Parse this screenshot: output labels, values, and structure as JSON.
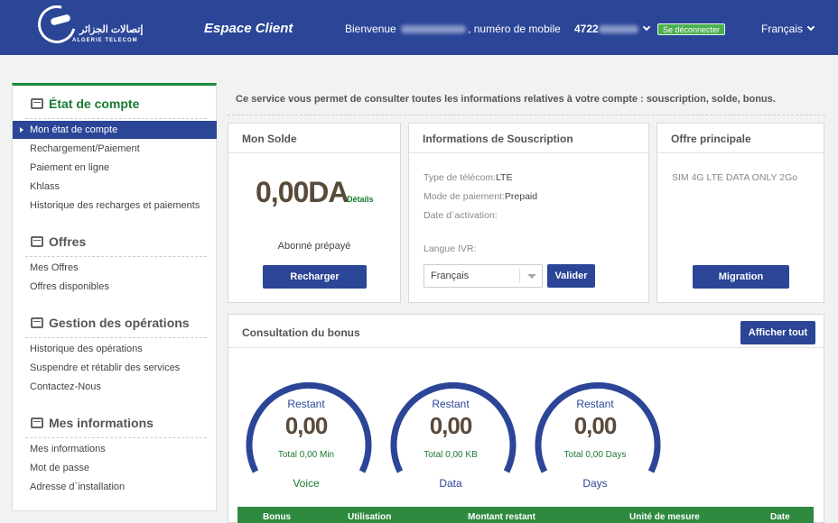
{
  "header": {
    "logo_arabic": "إتصالات الجزائر",
    "logo_latin": "ALGERIE TELECOM",
    "espace_title": "Espace Client",
    "welcome_prefix": "Bienvenue",
    "welcome_suffix": ", numéro de mobile",
    "phone_prefix": "4722",
    "logout_label": "Se déconnecter",
    "language": "Français"
  },
  "sidebar": {
    "sections": [
      {
        "title": "État de compte",
        "items": [
          "Mon état de compte",
          "Rechargement/Paiement",
          "Paiement en ligne",
          "Khlass",
          "Historique des recharges et paiements"
        ]
      },
      {
        "title": "Offres",
        "items": [
          "Mes Offres",
          "Offres disponibles"
        ]
      },
      {
        "title": "Gestion des opérations",
        "items": [
          "Historique des opérations",
          "Suspendre et rétablir des services",
          "Contactez-Nous"
        ]
      },
      {
        "title": "Mes informations",
        "items": [
          "Mes informations",
          "Mot de passe",
          "Adresse d`installation"
        ]
      }
    ]
  },
  "intro": "Ce service vous permet de consulter toutes les informations relatives à votre compte : souscription, solde, bonus.",
  "solde": {
    "title": "Mon Solde",
    "amount": "0,00",
    "currency": "DA",
    "details_label": "Détails",
    "status": "Abonné prépayé",
    "recharge_label": "Recharger"
  },
  "souscription": {
    "title": "Informations de Souscription",
    "type_label": "Type de télécom:",
    "type_value": "LTE",
    "payment_label": "Mode de paiement:",
    "payment_value": "Prepaid",
    "activation_label": "Date d`activation:",
    "ivr_label": "Langue IVR:",
    "ivr_value": "Français",
    "validate_label": "Valider"
  },
  "offre": {
    "title": "Offre principale",
    "value": "SIM 4G LTE DATA ONLY 2Go",
    "migration_label": "Migration"
  },
  "bonus": {
    "title": "Consultation du bonus",
    "show_all_label": "Afficher tout",
    "gauges": [
      {
        "label": "Restant",
        "value": "0,00",
        "total": "Total 0,00 Min",
        "name": "Voice",
        "name_color": "#1a7a32"
      },
      {
        "label": "Restant",
        "value": "0,00",
        "total": "Total 0,00 KB",
        "name": "Data",
        "name_color": "#2b4597"
      },
      {
        "label": "Restant",
        "value": "0,00",
        "total": "Total 0,00 Days",
        "name": "Days",
        "name_color": "#2b4597"
      }
    ],
    "columns": [
      "Bonus",
      "Utilisation",
      "Montant restant",
      "Unité de mesure",
      "Date"
    ]
  },
  "colors": {
    "brand_blue": "#2b4597",
    "accent_green": "#1a8a3c"
  }
}
